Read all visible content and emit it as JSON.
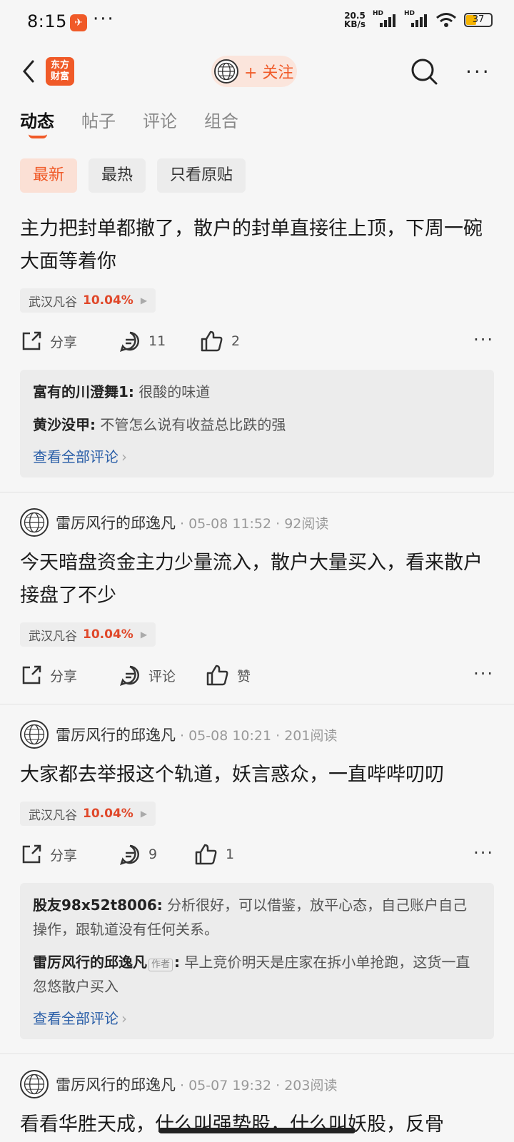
{
  "status_bar": {
    "time": "8:15",
    "app_icon_glyph": "✈",
    "more": "···",
    "speed_top": "20.5",
    "speed_bottom": "KB/s",
    "network": "HD",
    "battery": "37"
  },
  "header": {
    "logo_line1": "东方",
    "logo_line2": "财富",
    "follow_label": "+ 关注"
  },
  "tabs": [
    {
      "label": "动态"
    },
    {
      "label": "帖子"
    },
    {
      "label": "评论"
    },
    {
      "label": "组合"
    }
  ],
  "filters": [
    {
      "label": "最新"
    },
    {
      "label": "最热"
    },
    {
      "label": "只看原贴"
    }
  ],
  "posts": [
    {
      "body": "主力把封单都撤了，散户的封单直接往上顶，下周一碗大面等着你",
      "stock": "武汉凡谷",
      "change": "10.04%",
      "share": "分享",
      "comments": "11",
      "likes": "2",
      "replies": [
        {
          "name": "富有的川澄舞1:",
          "text": "很酸的味道"
        },
        {
          "name": "黄沙没甲:",
          "text": "不管怎么说有收益总比跌的强"
        }
      ],
      "view_all": "查看全部评论"
    },
    {
      "author": "雷厉风行的邱逸凡",
      "meta": "· 05-08 11:52 · 92阅读",
      "body": "今天暗盘资金主力少量流入，散户大量买入，看来散户接盘了不少",
      "stock": "武汉凡谷",
      "change": "10.04%",
      "share": "分享",
      "comments": "评论",
      "likes": "赞"
    },
    {
      "author": "雷厉风行的邱逸凡",
      "meta": "· 05-08 10:21 · 201阅读",
      "body": "大家都去举报这个轨道，妖言惑众，一直哔哔叨叨",
      "stock": "武汉凡谷",
      "change": "10.04%",
      "share": "分享",
      "comments": "9",
      "likes": "1",
      "replies": [
        {
          "name": "股友98x52t8006:",
          "text": "分析很好，可以借鉴，放平心态，自己账户自己操作，跟轨道没有任何关系。"
        },
        {
          "name": "雷厉风行的邱逸凡",
          "tag": "作者",
          "colon": ":",
          "text": "早上竞价明天是庄家在拆小单抢跑，这货一直忽悠散户买入"
        }
      ],
      "view_all": "查看全部评论"
    },
    {
      "author": "雷厉风行的邱逸凡",
      "meta": "· 05-07 19:32 · 203阅读",
      "body": "看看华胜天成，什么叫强势股，什么叫妖股，反骨"
    }
  ]
}
